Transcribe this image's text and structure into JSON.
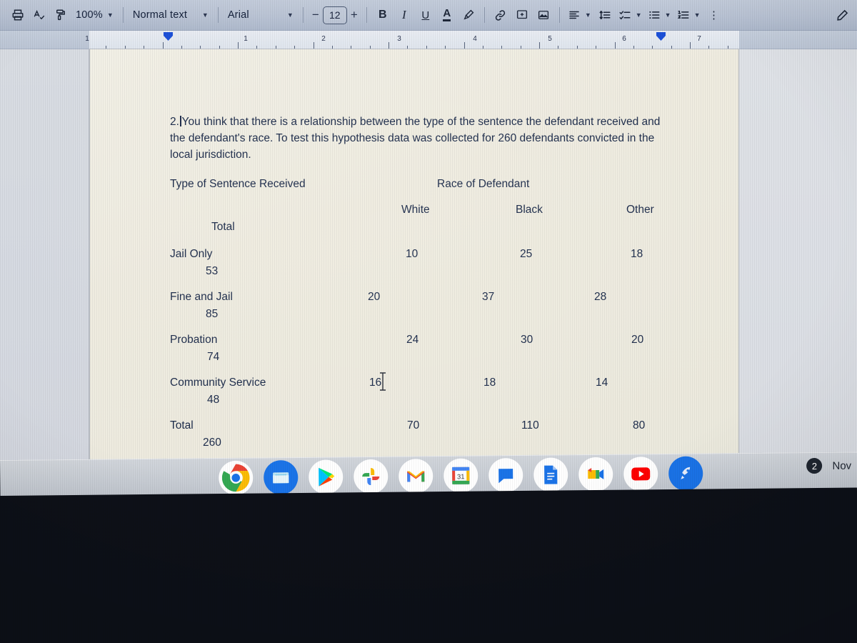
{
  "toolbar": {
    "print_label": "⎙",
    "spellcheck_label": "A",
    "paint_format_label": "⎙",
    "zoom_value": "100%",
    "style_value": "Normal text",
    "font_value": "Arial",
    "font_size_minus": "−",
    "font_size_value": "12",
    "font_size_plus": "+",
    "bold_label": "B",
    "italic_label": "I",
    "underline_label": "U",
    "text_color_label": "A",
    "highlight_label": "highlight-pen-icon",
    "link_label": "link-icon",
    "comment_label": "add-comment-icon",
    "image_label": "insert-image-icon",
    "align_label": "align-left-icon",
    "line_spacing_label": "line-spacing-icon",
    "checklist_label": "checklist-icon",
    "bulleted_list_label": "bulleted-list-icon",
    "numbered_list_label": "numbered-list-icon",
    "more_label": "⋮",
    "edit_mode_label": "pencil-icon"
  },
  "ruler": {
    "numbers": [
      "1",
      "1",
      "2",
      "3",
      "4",
      "5",
      "6",
      "7"
    ],
    "left_indent_position": "1",
    "right_indent_position": "6.5"
  },
  "document": {
    "question": {
      "number": "2.",
      "text": "You think that there is a relationship between the type of the sentence the defendant received and the defendant's race. To test this hypothesis data was collected for 260 defendants convicted in the local jurisdiction."
    },
    "table": {
      "row_header": "Type of Sentence Received",
      "col_group_header": "Race of Defendant",
      "column_headers": [
        "White",
        "Black",
        "Other"
      ],
      "total_header": "Total",
      "rows": [
        {
          "label": "Jail Only",
          "values": [
            "10",
            "25",
            "18"
          ],
          "total": "53"
        },
        {
          "label": "Fine and Jail",
          "values": [
            "20",
            "37",
            "28"
          ],
          "total": "85"
        },
        {
          "label": "Probation",
          "values": [
            "24",
            "30",
            "20"
          ],
          "total": "74"
        },
        {
          "label": "Community Service",
          "values": [
            "16",
            "18",
            "14"
          ],
          "total": "48"
        }
      ],
      "total_row": {
        "label": "Total",
        "values": [
          "70",
          "110",
          "80"
        ],
        "total": "260"
      }
    }
  },
  "shelf": {
    "apps": [
      {
        "name": "chrome",
        "active": true
      },
      {
        "name": "files",
        "active": false
      },
      {
        "name": "play-store",
        "active": false
      },
      {
        "name": "google-photos",
        "active": false
      },
      {
        "name": "gmail",
        "active": false
      },
      {
        "name": "google-calendar",
        "active": false,
        "day": "31"
      },
      {
        "name": "google-chat",
        "active": false
      },
      {
        "name": "google-docs",
        "active": true
      },
      {
        "name": "google-meet",
        "active": false
      },
      {
        "name": "youtube",
        "active": false
      },
      {
        "name": "explore-rocket",
        "active": true
      }
    ],
    "notification_count": "2",
    "clock": "Nov"
  },
  "colors": {
    "doc_text": "#1c2b4a",
    "page_bg": "#efece0",
    "toolbar_bg": "#bcc6d6",
    "indent_marker": "#1b4fd8"
  }
}
